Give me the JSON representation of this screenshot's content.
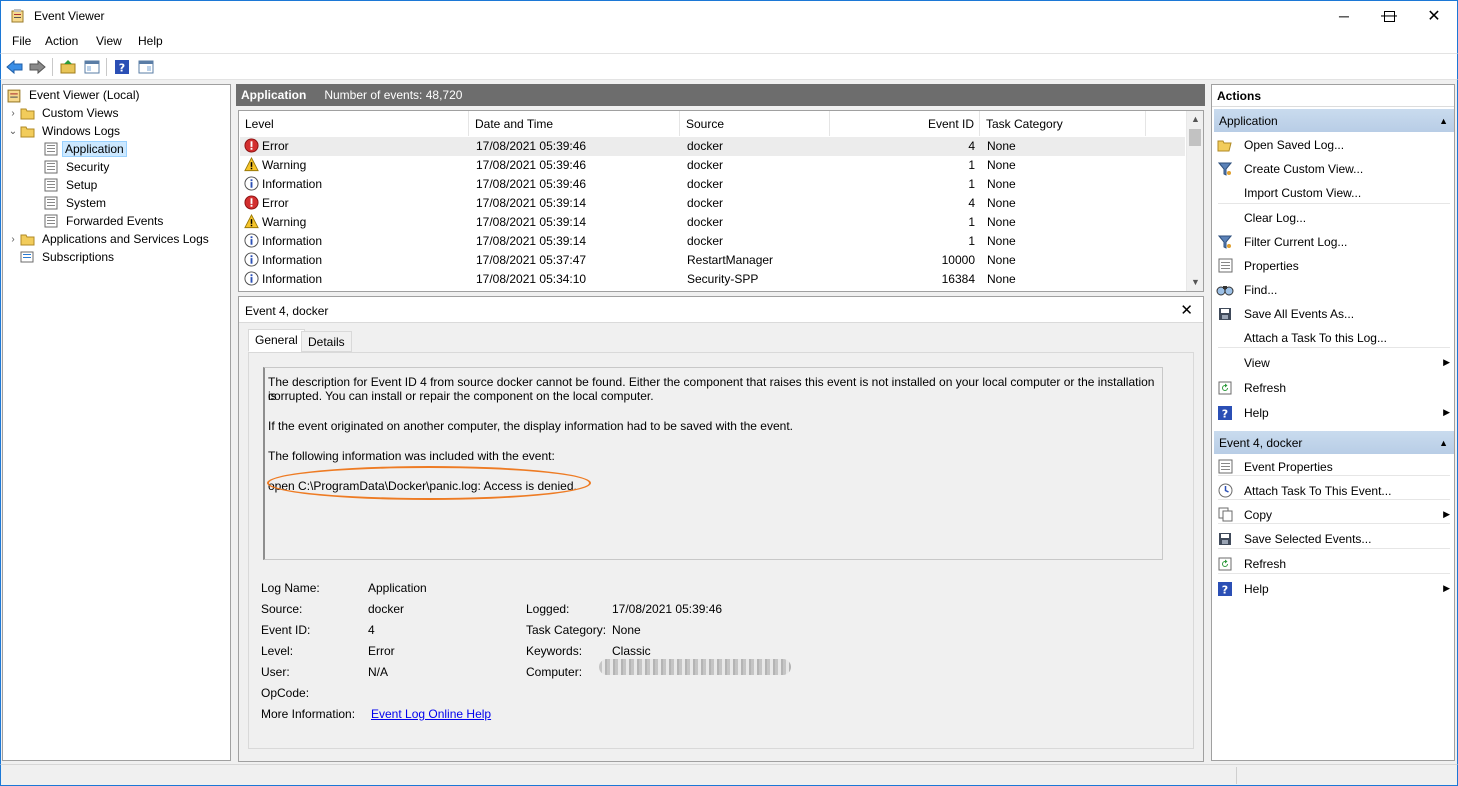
{
  "window": {
    "title": "Event Viewer"
  },
  "menu": [
    "File",
    "Action",
    "View",
    "Help"
  ],
  "tree": {
    "root": "Event Viewer (Local)",
    "custom_views": "Custom Views",
    "windows_logs": "Windows Logs",
    "children": [
      "Application",
      "Security",
      "Setup",
      "System",
      "Forwarded Events"
    ],
    "apps_services": "Applications and Services Logs",
    "subscriptions": "Subscriptions"
  },
  "center": {
    "log_name": "Application",
    "event_count": "Number of events: 48,720"
  },
  "columns": [
    "Level",
    "Date and Time",
    "Source",
    "Event ID",
    "Task Category"
  ],
  "events": [
    {
      "level": "Error",
      "date": "17/08/2021 05:39:46",
      "source": "docker",
      "id": "4",
      "task": "None"
    },
    {
      "level": "Warning",
      "date": "17/08/2021 05:39:46",
      "source": "docker",
      "id": "1",
      "task": "None"
    },
    {
      "level": "Information",
      "date": "17/08/2021 05:39:46",
      "source": "docker",
      "id": "1",
      "task": "None"
    },
    {
      "level": "Error",
      "date": "17/08/2021 05:39:14",
      "source": "docker",
      "id": "4",
      "task": "None"
    },
    {
      "level": "Warning",
      "date": "17/08/2021 05:39:14",
      "source": "docker",
      "id": "1",
      "task": "None"
    },
    {
      "level": "Information",
      "date": "17/08/2021 05:39:14",
      "source": "docker",
      "id": "1",
      "task": "None"
    },
    {
      "level": "Information",
      "date": "17/08/2021 05:37:47",
      "source": "RestartManager",
      "id": "10000",
      "task": "None"
    },
    {
      "level": "Information",
      "date": "17/08/2021 05:34:10",
      "source": "Security-SPP",
      "id": "16384",
      "task": "None"
    }
  ],
  "detail": {
    "header": "Event 4, docker",
    "tabs": [
      "General",
      "Details"
    ],
    "desc1": "The description for Event ID 4 from source docker cannot be found. Either the component that raises this event is not installed on your local computer or the installation is",
    "desc1b": "corrupted. You can install or repair the component on the local computer.",
    "desc2": "If the event originated on another computer, the display information had to be saved with the event.",
    "desc3": "The following information was included with the event:",
    "desc4": "open C:\\ProgramData\\Docker\\panic.log: Access is denied.",
    "labels": {
      "log_name": "Log Name:",
      "source": "Source:",
      "event_id": "Event ID:",
      "level": "Level:",
      "user": "User:",
      "opcode": "OpCode:",
      "more_info": "More Information:",
      "logged": "Logged:",
      "task_category": "Task Category:",
      "keywords": "Keywords:",
      "computer": "Computer:"
    },
    "values": {
      "log_name": "Application",
      "source": "docker",
      "event_id": "4",
      "level": "Error",
      "user": "N/A",
      "more_info": "Event Log Online Help",
      "logged": "17/08/2021 05:39:46",
      "task_category": "None",
      "keywords": "Classic"
    }
  },
  "actions": {
    "title": "Actions",
    "group1": "Application",
    "items1": [
      "Open Saved Log...",
      "Create Custom View...",
      "Import Custom View...",
      "Clear Log...",
      "Filter Current Log...",
      "Properties",
      "Find...",
      "Save All Events As...",
      "Attach a Task To this Log...",
      "View",
      "Refresh",
      "Help"
    ],
    "group2": "Event 4, docker",
    "items2": [
      "Event Properties",
      "Attach Task To This Event...",
      "Copy",
      "Save Selected Events...",
      "Refresh",
      "Help"
    ]
  },
  "colors": {
    "title_border": "#1c78d6",
    "highlight_oval": "#ee7b23",
    "selection": "#cce8ff",
    "center_header": "#6d6d6d",
    "group_header": "#c9dbee"
  }
}
